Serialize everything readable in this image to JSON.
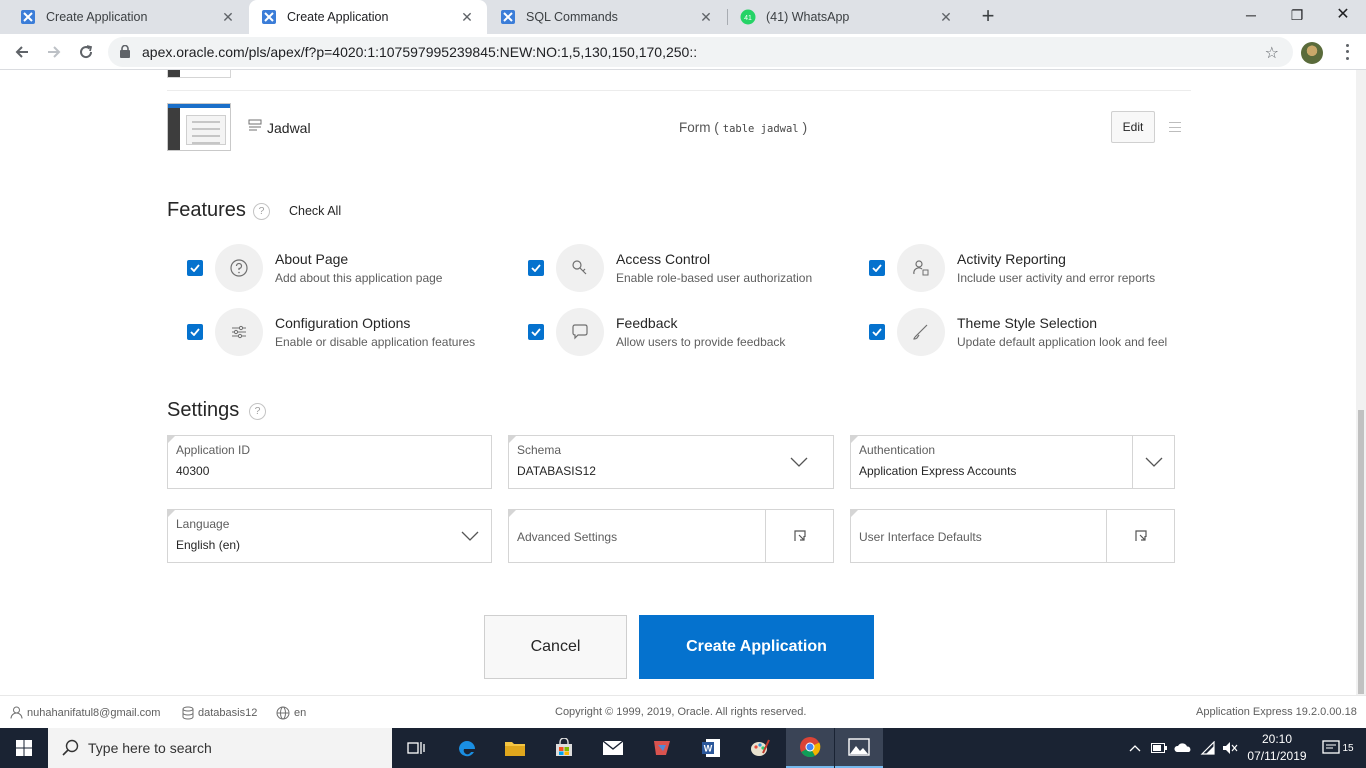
{
  "browser": {
    "tabs": [
      {
        "title": "Create Application",
        "active": false
      },
      {
        "title": "Create Application",
        "active": true
      },
      {
        "title": "SQL Commands",
        "active": false
      },
      {
        "title": "(41) WhatsApp",
        "active": false,
        "badge": "41"
      }
    ],
    "url": "apex.oracle.com/pls/apex/f?p=4020:1:107597995239845:NEW:NO:1,5,130,150,170,250::"
  },
  "pages": {
    "item": {
      "name": "Jadwal",
      "type_prefix": "Form (",
      "type_code": "table jadwal",
      "type_suffix": ")",
      "edit_label": "Edit"
    }
  },
  "features": {
    "title": "Features",
    "help": "?",
    "check_all": "Check All",
    "items": [
      {
        "name": "About Page",
        "desc": "Add about this application page",
        "icon": "question-circle-icon",
        "checked": true
      },
      {
        "name": "Access Control",
        "desc": "Enable role-based user authorization",
        "icon": "key-icon",
        "checked": true
      },
      {
        "name": "Activity Reporting",
        "desc": "Include user activity and error reports",
        "icon": "user-chart-icon",
        "checked": true
      },
      {
        "name": "Configuration Options",
        "desc": "Enable or disable application features",
        "icon": "sliders-icon",
        "checked": true
      },
      {
        "name": "Feedback",
        "desc": "Allow users to provide feedback",
        "icon": "comment-icon",
        "checked": true
      },
      {
        "name": "Theme Style Selection",
        "desc": "Update default application look and feel",
        "icon": "brush-icon",
        "checked": true
      }
    ]
  },
  "settings": {
    "title": "Settings",
    "help": "?",
    "app_id_label": "Application ID",
    "app_id_value": "40300",
    "schema_label": "Schema",
    "schema_value": "DATABASIS12",
    "auth_label": "Authentication",
    "auth_value": "Application Express Accounts",
    "language_label": "Language",
    "language_value": "English (en)",
    "advanced_label": "Advanced Settings",
    "ui_defaults_label": "User Interface Defaults"
  },
  "actions": {
    "cancel": "Cancel",
    "create": "Create Application"
  },
  "footer": {
    "user": "nuhahanifatul8@gmail.com",
    "workspace": "databasis12",
    "language": "en",
    "copyright": "Copyright © 1999, 2019, Oracle. All rights reserved.",
    "version": "Application Express 19.2.0.00.18"
  },
  "taskbar": {
    "search_placeholder": "Type here to search",
    "time": "20:10",
    "date": "07/11/2019",
    "notifications": "15"
  },
  "colors": {
    "accent": "#0572ce",
    "taskbar": "#1a2333"
  }
}
